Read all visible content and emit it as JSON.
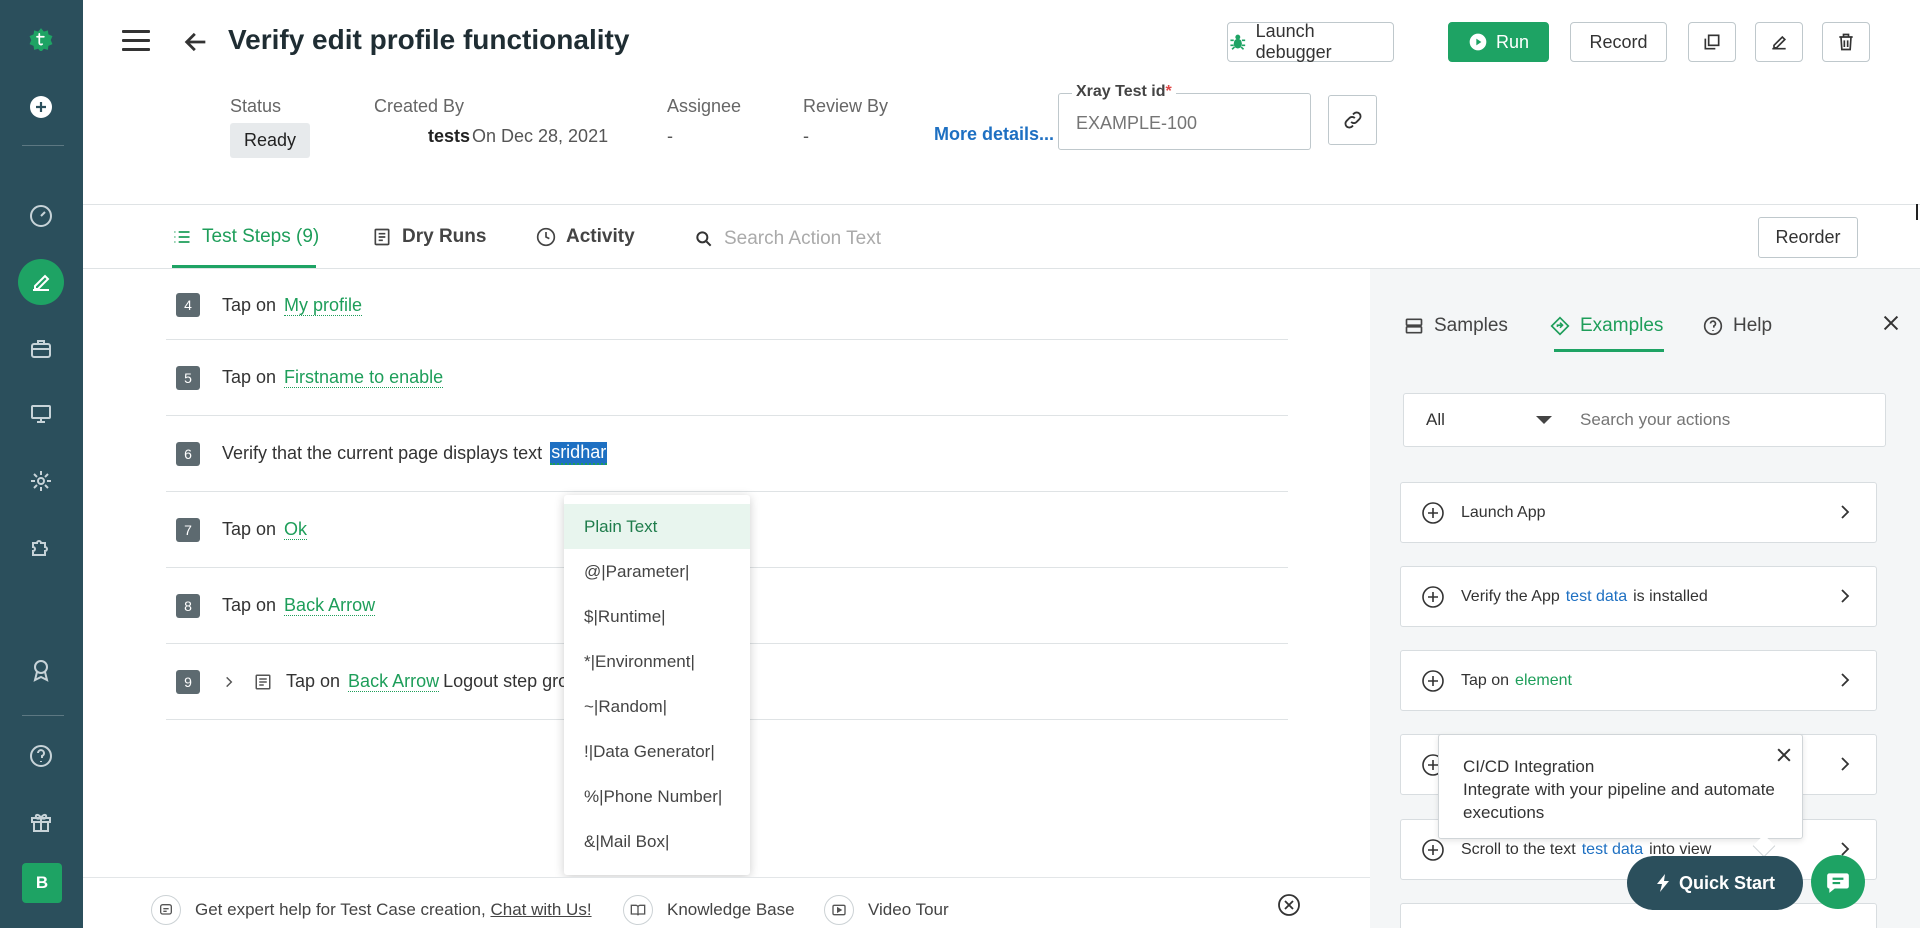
{
  "header": {
    "title": "Verify edit profile functionality",
    "buttons": {
      "launch_debugger": "Launch debugger",
      "run": "Run",
      "record": "Record"
    }
  },
  "meta": {
    "status_label": "Status",
    "status_value": "Ready",
    "created_by_label": "Created By",
    "created_by_user": "tests",
    "created_on": "On Dec 28, 2021",
    "assignee_label": "Assignee",
    "assignee_value": "-",
    "review_label": "Review By",
    "review_value": "-",
    "more_details": "More details...",
    "xray_label": "Xray Test id",
    "xray_required": "*",
    "xray_placeholder": "EXAMPLE-100"
  },
  "tabs": {
    "test_steps": "Test Steps (9)",
    "dry_runs": "Dry Runs",
    "activity": "Activity",
    "search_placeholder": "Search Action Text",
    "reorder": "Reorder"
  },
  "steps": [
    {
      "num": "4",
      "text": "Tap on",
      "element": "My profile"
    },
    {
      "num": "5",
      "text": "Tap on",
      "element": "Firstname to enable"
    },
    {
      "num": "6",
      "text": "Verify that the current page displays text",
      "element": "sridhar"
    },
    {
      "num": "7",
      "text": "Tap on",
      "element": "Ok"
    },
    {
      "num": "8",
      "text": "Tap on",
      "element": "Back Arrow"
    },
    {
      "num": "9",
      "text": "Tap on",
      "element": "Back Arrow",
      "tail": "Logout step grou"
    }
  ],
  "dropdown": {
    "items": [
      "Plain Text",
      "@|Parameter|",
      "$|Runtime|",
      "*|Environment|",
      "~|Random|",
      "!|Data Generator|",
      "%|Phone Number|",
      "&|Mail Box|"
    ],
    "selected": "Plain Text"
  },
  "right_panel": {
    "tabs": {
      "samples": "Samples",
      "examples": "Examples",
      "help": "Help"
    },
    "filter_value": "All",
    "search_placeholder": "Search your actions",
    "cards": [
      {
        "pre": "Launch App",
        "hl": "",
        "post": ""
      },
      {
        "pre": "Verify the App",
        "hl": "test data",
        "post": "is installed"
      },
      {
        "pre": "Tap on",
        "hl": "element",
        "post": ""
      },
      {
        "pre": "",
        "hl": "",
        "post": ""
      },
      {
        "pre": "Scroll to the text",
        "hl": "test data",
        "post": "into view"
      }
    ]
  },
  "tooltip": {
    "title": "CI/CD Integration",
    "body": "Integrate with your pipeline and automate executions"
  },
  "quick_start": "Quick Start",
  "footer": {
    "help_text": "Get expert help for Test Case creation,",
    "chat_link": "Chat with Us!",
    "knowledge_base": "Knowledge Base",
    "video_tour": "Video Tour"
  },
  "user": {
    "avatar_letter": "B"
  },
  "colors": {
    "rail": "#2b4f5c",
    "accent": "#1ea364",
    "link": "#1e70c2"
  }
}
